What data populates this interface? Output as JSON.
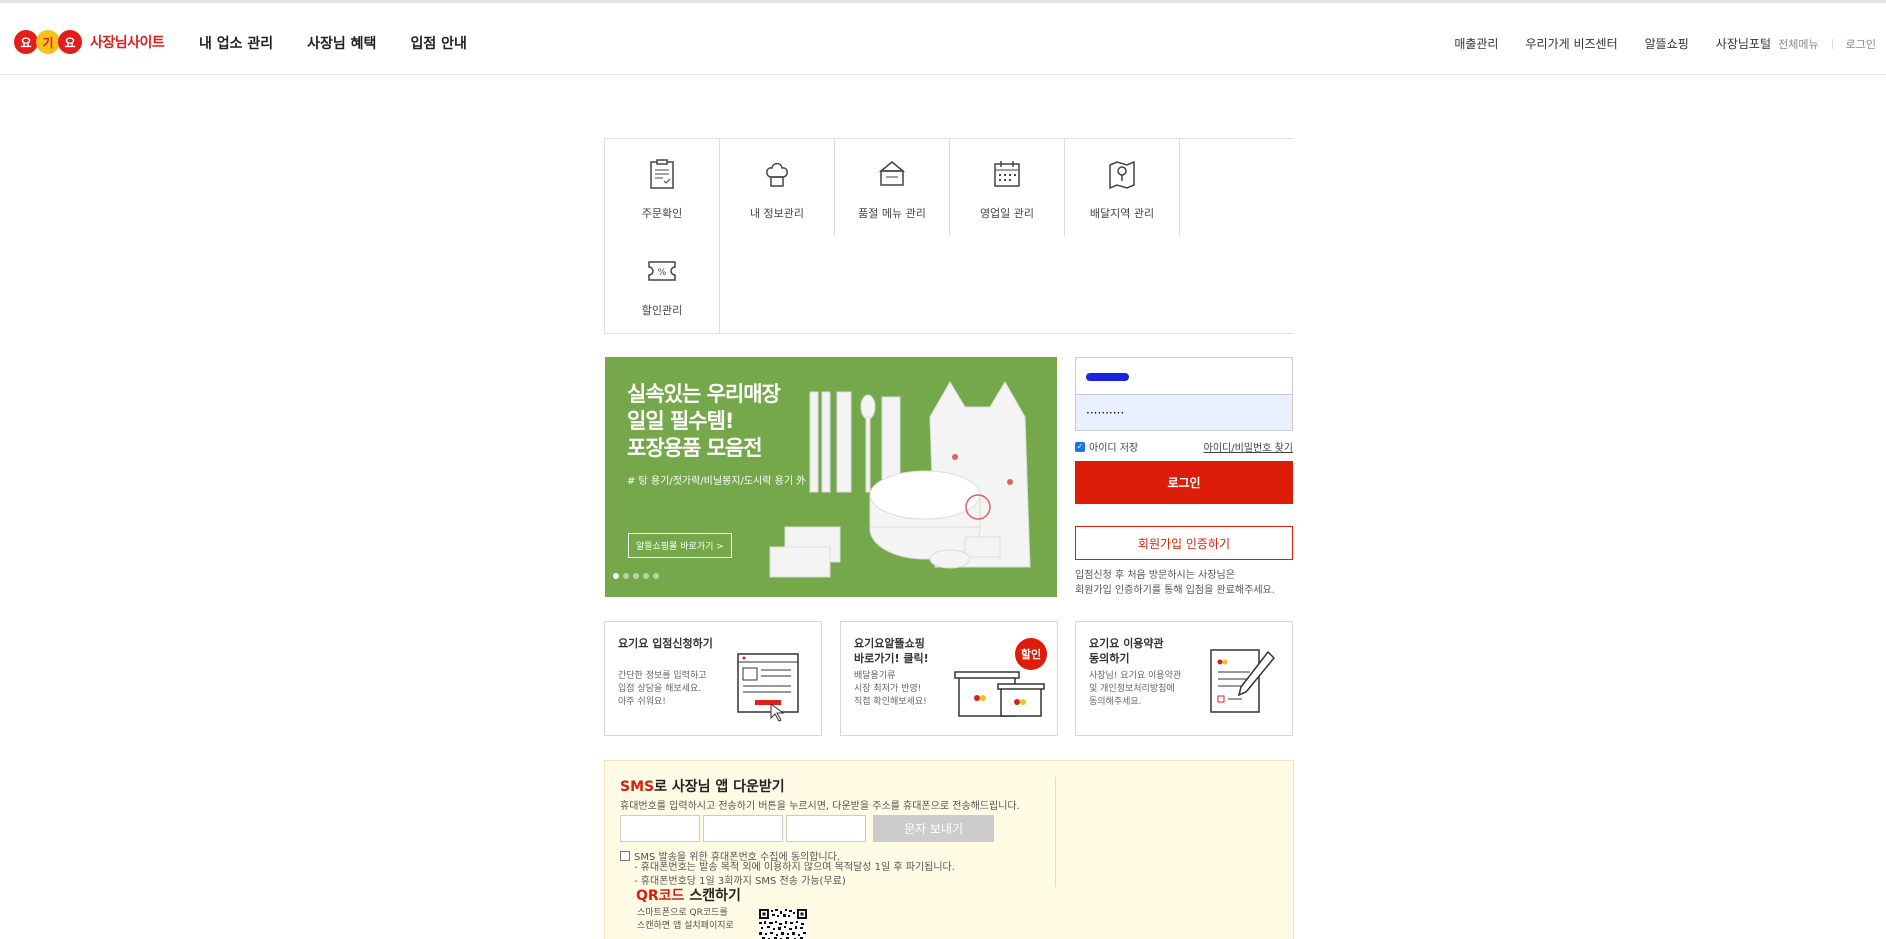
{
  "header": {
    "logo_chars": [
      "요",
      "기",
      "요"
    ],
    "logo_text": "사장님사이트",
    "nav": [
      "내 업소 관리",
      "사장님 혜택",
      "입점 안내"
    ],
    "util_links": [
      "매출관리",
      "우리가게 비즈센터",
      "알뜰쇼핑",
      "사장님포털"
    ],
    "all_menu": "전체메뉴",
    "login": "로그인"
  },
  "quick_menu": [
    {
      "label": "주문확인",
      "icon": "clipboard-icon"
    },
    {
      "label": "내 정보관리",
      "icon": "chef-hat-icon"
    },
    {
      "label": "품절 메뉴 관리",
      "icon": "menu-sign-icon"
    },
    {
      "label": "영업일 관리",
      "icon": "calendar-icon"
    },
    {
      "label": "배달지역 관리",
      "icon": "map-pin-icon"
    },
    {
      "label": "할인관리",
      "icon": "coupon-icon"
    }
  ],
  "banner": {
    "title_lines": [
      "실속있는 우리매장",
      "일일 필수템!",
      "포장용품 모음전"
    ],
    "subtitle": "# 탕 용기/젓가락/비닐봉지/도시락 용기 外",
    "button": "알뜰쇼핑몰 바로가기 >",
    "slide_count": 5,
    "active_slide": 1,
    "bg_color": "#74a84a"
  },
  "login": {
    "password_value": "··········",
    "save_id": "아이디 저장",
    "find_link": "아이디/비밀번호 찾기",
    "login_button": "로그인",
    "join_button": "회원가입 인증하기",
    "join_desc_lines": [
      "입점신청 후 처음 방문하시는 사장님은",
      "회원가입 인증하기를 통해 입점을 완료해주세요."
    ],
    "accent": "#dd1c0a"
  },
  "cards": [
    {
      "title": "요기요 입점신청하기",
      "desc": "간단한 정보를 입력하고\n입점 상담을 해보세요.\n아주 쉬워요!",
      "icon": "browser-form-icon"
    },
    {
      "title": "요기요알뜰쇼핑\n바로가기! 클릭!",
      "desc": "배달용기류\n시장 최저가 반영!\n직접 확인해보세요!",
      "icon": "container-sale-icon",
      "badge": "할인"
    },
    {
      "title": "요기요 이용약관\n동의하기",
      "desc": "사장님! 요기요 이용약관\n및 개인정보처리방침에\n동의해주세요.",
      "icon": "document-pen-icon"
    }
  ],
  "sms": {
    "title_red": "SMS",
    "title_rest": "로 사장님 앱 다운받기",
    "desc": "휴대번호를 입력하시고 전송하기 버튼을 누르시면, 다운받을 주소를 휴대폰으로 전송해드립니다.",
    "send_button": "문자 보내기",
    "agree": "SMS 발송을 위한 휴대폰번호 수집에 동의합니다.",
    "notes": [
      "- 휴대폰번호는 발송 목적 외에 이용하지 않으며 목적달성 1일 후 파기됩니다.",
      "- 휴대폰번호당 1일 3회까지 SMS 전송 가능(무료)"
    ],
    "qr_title_red": "QR코드",
    "qr_title_rest": " 스캔하기",
    "qr_desc": "스마트폰으로 QR코드를\n스캔하면 앱 설치페이지로"
  }
}
